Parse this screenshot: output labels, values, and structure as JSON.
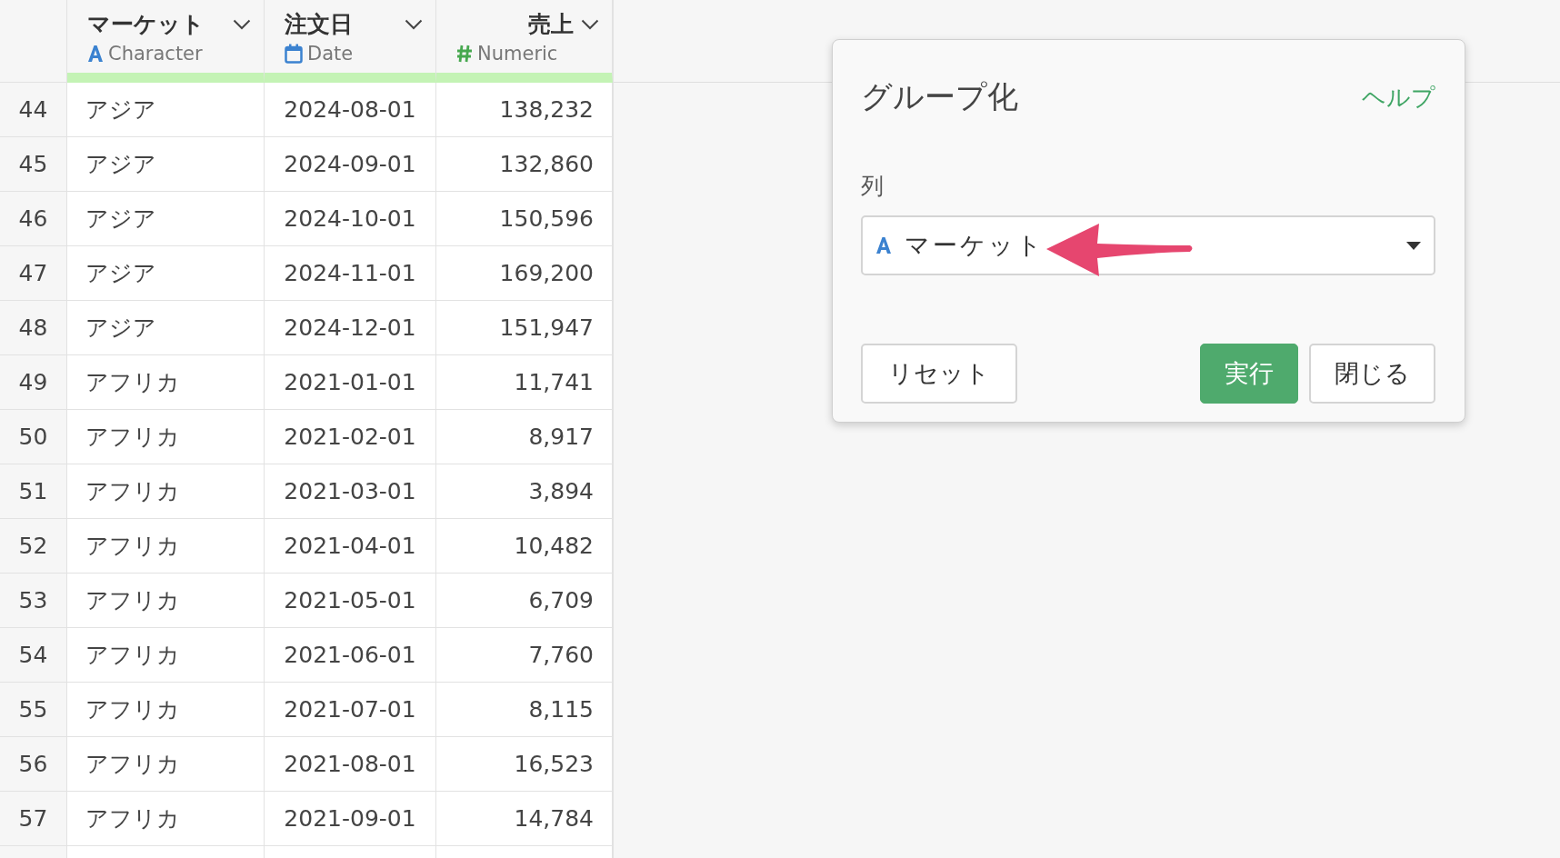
{
  "table": {
    "columns": [
      {
        "name": "マーケット",
        "type_label": "Character",
        "kind": "character"
      },
      {
        "name": "注文日",
        "type_label": "Date",
        "kind": "date"
      },
      {
        "name": "売上",
        "type_label": "Numeric",
        "kind": "numeric"
      }
    ],
    "rows": [
      {
        "index": "44",
        "cells": [
          "アジア",
          "2024-08-01",
          "138,232"
        ]
      },
      {
        "index": "45",
        "cells": [
          "アジア",
          "2024-09-01",
          "132,860"
        ]
      },
      {
        "index": "46",
        "cells": [
          "アジア",
          "2024-10-01",
          "150,596"
        ]
      },
      {
        "index": "47",
        "cells": [
          "アジア",
          "2024-11-01",
          "169,200"
        ]
      },
      {
        "index": "48",
        "cells": [
          "アジア",
          "2024-12-01",
          "151,947"
        ]
      },
      {
        "index": "49",
        "cells": [
          "アフリカ",
          "2021-01-01",
          "11,741"
        ]
      },
      {
        "index": "50",
        "cells": [
          "アフリカ",
          "2021-02-01",
          "8,917"
        ]
      },
      {
        "index": "51",
        "cells": [
          "アフリカ",
          "2021-03-01",
          "3,894"
        ]
      },
      {
        "index": "52",
        "cells": [
          "アフリカ",
          "2021-04-01",
          "10,482"
        ]
      },
      {
        "index": "53",
        "cells": [
          "アフリカ",
          "2021-05-01",
          "6,709"
        ]
      },
      {
        "index": "54",
        "cells": [
          "アフリカ",
          "2021-06-01",
          "7,760"
        ]
      },
      {
        "index": "55",
        "cells": [
          "アフリカ",
          "2021-07-01",
          "8,115"
        ]
      },
      {
        "index": "56",
        "cells": [
          "アフリカ",
          "2021-08-01",
          "16,523"
        ]
      },
      {
        "index": "57",
        "cells": [
          "アフリカ",
          "2021-09-01",
          "14,784"
        ]
      }
    ]
  },
  "dialog": {
    "title": "グループ化",
    "help_link": "ヘルプ",
    "field_label": "列",
    "select": {
      "value": "マーケット",
      "kind": "character"
    },
    "buttons": [
      {
        "label": "リセット",
        "kind": "default"
      },
      {
        "label": "実行",
        "kind": "primary"
      },
      {
        "label": "閉じる",
        "kind": "default"
      }
    ]
  }
}
